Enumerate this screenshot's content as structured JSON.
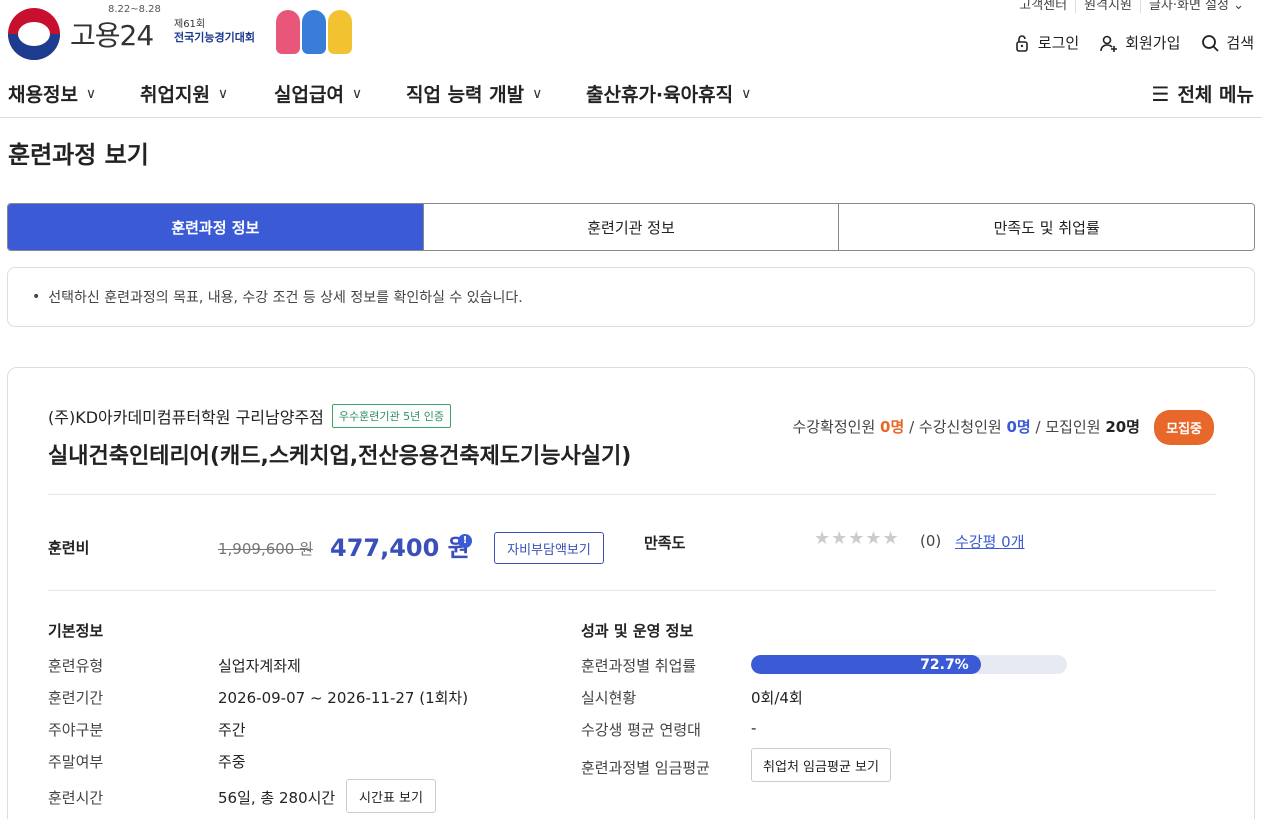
{
  "header": {
    "util_links": [
      "고객센터",
      "원격지원",
      "글자·화면 설정 ⌄"
    ],
    "logo_text": "고용24",
    "logo_date": "8.22~8.28",
    "event_line1": "제61회",
    "event_line2": "전국기능경기대회",
    "login": "로그인",
    "signup": "회원가입",
    "search": "검색"
  },
  "gnb": {
    "items": [
      "채용정보",
      "취업지원",
      "실업급여",
      "직업 능력 개발",
      "출산휴가·육아휴직"
    ],
    "all_menu": "전체 메뉴"
  },
  "page_title": "훈련과정 보기",
  "tabs": [
    "훈련과정 정보",
    "훈련기관 정보",
    "만족도 및 취업률"
  ],
  "notice": "선택하신 훈련과정의 목표, 내용, 수강 조건 등 상세 정보를 확인하실 수 있습니다.",
  "course": {
    "institution": "(주)KD아카데미컴퓨터학원 구리남양주점",
    "cert_badge": "우수훈련기관 5년 인증",
    "title": "실내건축인테리어(캐드,스케치업,전산응용건축제도기능사실기)",
    "stats": {
      "confirmed_label": "수강확정인원",
      "confirmed": "0명",
      "applied_label": "수강신청인원",
      "applied": "0명",
      "recruit_label": "모집인원",
      "recruit": "20명"
    },
    "status": "모집중",
    "fee_label": "훈련비",
    "fee_original": "1,909,600 원",
    "fee_current": "477,400 원",
    "fee_button": "자비부담액보기",
    "satisfaction_label": "만족도",
    "stars": "★★★★★",
    "rating_stars": 0,
    "satisfaction_count": "(0)",
    "review_link": "수강평 0개",
    "basic_title": "기본정보",
    "basic": [
      {
        "label": "훈련유형",
        "value": "실업자계좌제"
      },
      {
        "label": "훈련기간",
        "value": "2026-09-07 ~ 2026-11-27 (1회차)"
      },
      {
        "label": "주야구분",
        "value": "주간"
      },
      {
        "label": "주말여부",
        "value": "주중"
      },
      {
        "label": "훈련시간",
        "value": "56일, 총 280시간"
      }
    ],
    "timetable_button": "시간표 보기",
    "perf_title": "성과 및 운영 정보",
    "perf": [
      {
        "label": "훈련과정별 취업률",
        "value": "72.7%"
      },
      {
        "label": "실시현황",
        "value": "0회/4회"
      },
      {
        "label": "수강생 평균 연령대",
        "value": "-"
      },
      {
        "label": "훈련과정별 임금평균",
        "value": ""
      }
    ],
    "employment_rate": 72.7,
    "wage_button": "취업처 임금평균 보기"
  },
  "colors": {
    "primary": "#3b5bd6",
    "orange": "#e8672a",
    "green": "#2f8f5a"
  }
}
